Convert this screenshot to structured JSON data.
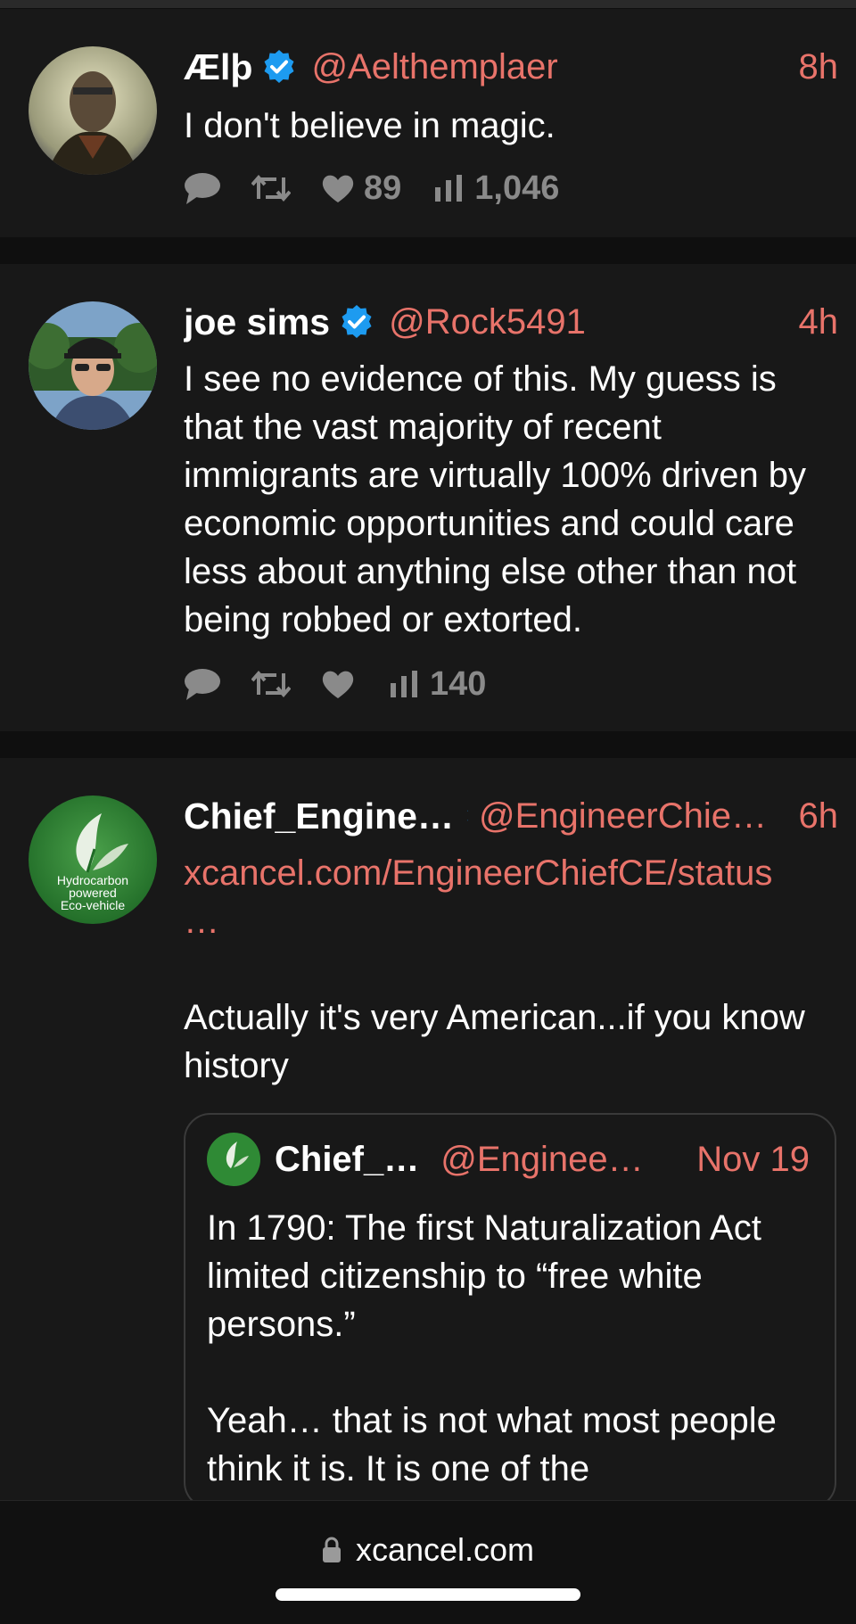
{
  "tweets": [
    {
      "name": "Ælþ",
      "handle": "@Aelthemplaer",
      "time": "8h",
      "verified": true,
      "text": "I don't believe in magic.",
      "likes": "89",
      "views": "1,046"
    },
    {
      "name": "joe sims",
      "handle": "@Rock5491",
      "time": "4h",
      "verified": true,
      "text": "I see no evidence of this. My guess is that the vast majority of recent immigrants are virtually 100% driven by economic opportunities and could care less about anything else other than not being robbed or extorted.",
      "likes": "",
      "views": "140"
    },
    {
      "name": "Chief_Engine…",
      "handle": "@EngineerChie…",
      "time": "6h",
      "verified": true,
      "link": "xcancel.com/EngineerChiefCE/status\n…",
      "text": "Actually it's very American...if you know history",
      "avatar_text": [
        "Hydrocarbon",
        "powered",
        "Eco-vehicle"
      ]
    }
  ],
  "quote": {
    "name": "Chief_…",
    "handle": "@Engineer…",
    "time": "Nov 19",
    "text": "In 1790: The first Naturalization Act limited citizenship to “free white persons.”\n\nYeah… that is not what most people think it is. It is one of the"
  },
  "browser": {
    "url": "xcancel.com"
  },
  "colors": {
    "accent": "#e8736a",
    "background": "#181818",
    "verified": "#1d9bf0",
    "icon_gray": "#8a8a8a"
  },
  "icons": [
    "reply-icon",
    "retweet-icon",
    "like-icon",
    "views-icon",
    "verified-icon",
    "lock-icon"
  ]
}
